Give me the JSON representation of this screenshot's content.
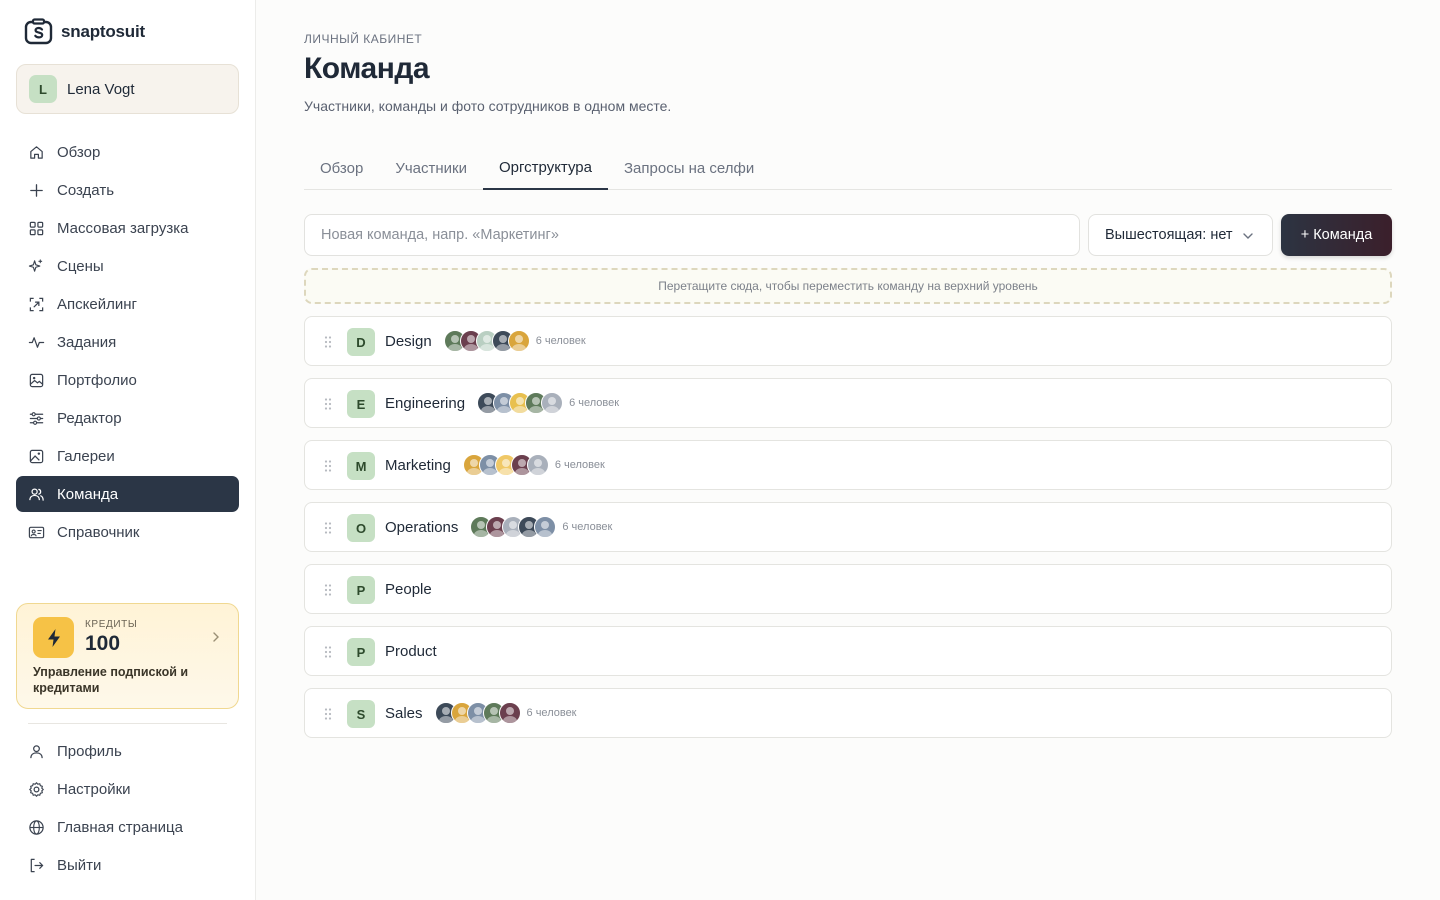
{
  "brand": {
    "name": "snaptosuit"
  },
  "user": {
    "initial": "L",
    "name": "Lena Vogt"
  },
  "nav": [
    {
      "label": "Обзор",
      "icon": "home-icon"
    },
    {
      "label": "Создать",
      "icon": "plus-icon"
    },
    {
      "label": "Массовая загрузка",
      "icon": "grid-icon"
    },
    {
      "label": "Сцены",
      "icon": "sparkles-icon"
    },
    {
      "label": "Апскейлинг",
      "icon": "upscale-icon"
    },
    {
      "label": "Задания",
      "icon": "activity-icon"
    },
    {
      "label": "Портфолио",
      "icon": "image-icon"
    },
    {
      "label": "Редактор",
      "icon": "sliders-icon"
    },
    {
      "label": "Галереи",
      "icon": "gallery-icon"
    },
    {
      "label": "Команда",
      "icon": "users-icon",
      "active": true
    },
    {
      "label": "Справочник",
      "icon": "id-card-icon"
    }
  ],
  "credits": {
    "label": "КРЕДИТЫ",
    "value": "100",
    "link": "Управление подпиской и кредитами",
    "accent": "#f6c246"
  },
  "nav_bottom": [
    {
      "label": "Профиль",
      "icon": "user-icon"
    },
    {
      "label": "Настройки",
      "icon": "gear-icon"
    },
    {
      "label": "Главная страница",
      "icon": "globe-icon"
    },
    {
      "label": "Выйти",
      "icon": "logout-icon"
    }
  ],
  "header": {
    "eyebrow": "ЛИЧНЫЙ КАБИНЕТ",
    "title": "Команда",
    "subtitle": "Участники, команды и фото сотрудников в одном месте."
  },
  "tabs": [
    {
      "label": "Обзор"
    },
    {
      "label": "Участники"
    },
    {
      "label": "Оргструктура",
      "active": true
    },
    {
      "label": "Запросы на селфи"
    }
  ],
  "form": {
    "placeholder": "Новая команда, напр. «Маркетинг»",
    "value": "",
    "parent_select": "Вышестоящая: нет",
    "add_button": "+ Команда"
  },
  "dropzone": "Перетащите сюда, чтобы переместить команду на верхний уровень",
  "teams": [
    {
      "initial": "D",
      "name": "Design",
      "count": "6 человек",
      "avatars": [
        "#5e7a5a",
        "#6b3f4e",
        "#b9cfc2",
        "#3d4a59",
        "#d9a53c"
      ]
    },
    {
      "initial": "E",
      "name": "Engineering",
      "count": "6 человек",
      "avatars": [
        "#3d4a59",
        "#7d8fa6",
        "#e8c04f",
        "#5e7a5a",
        "#a9b0bb"
      ]
    },
    {
      "initial": "M",
      "name": "Marketing",
      "count": "6 человек",
      "avatars": [
        "#d9a53c",
        "#7d8fa6",
        "#f0c866",
        "#6b3f4e",
        "#a9b0bb"
      ]
    },
    {
      "initial": "O",
      "name": "Operations",
      "count": "6 человек",
      "avatars": [
        "#5e7a5a",
        "#6b3f4e",
        "#a9b0bb",
        "#3d4a59",
        "#7d8fa6"
      ]
    },
    {
      "initial": "P",
      "name": "People",
      "count": "",
      "avatars": []
    },
    {
      "initial": "P",
      "name": "Product",
      "count": "",
      "avatars": []
    },
    {
      "initial": "S",
      "name": "Sales",
      "count": "6 человек",
      "avatars": [
        "#3d4a59",
        "#d9a53c",
        "#7d8fa6",
        "#5e7a5a",
        "#6b3f4e"
      ]
    }
  ]
}
